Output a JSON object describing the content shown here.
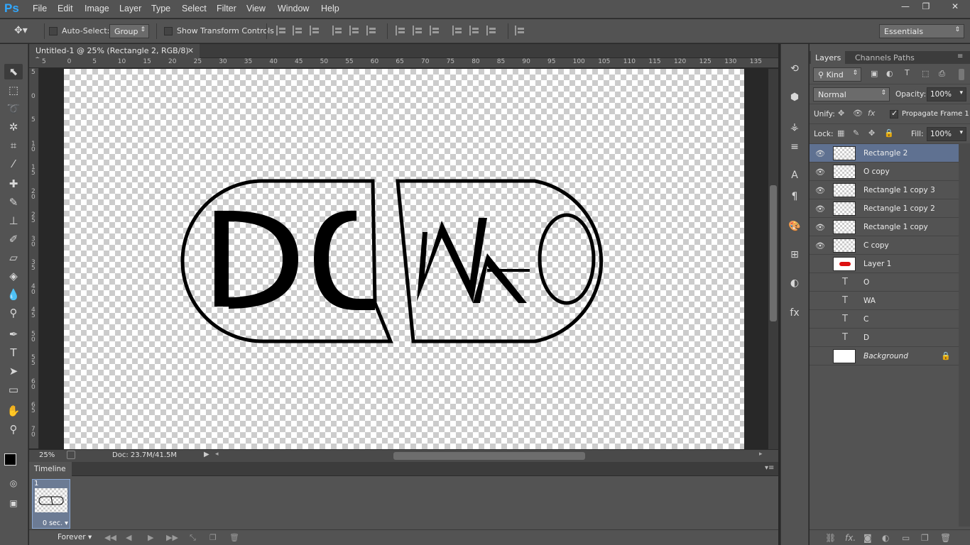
{
  "app": {
    "logo": "Ps"
  },
  "menu": [
    "File",
    "Edit",
    "Image",
    "Layer",
    "Type",
    "Select",
    "Filter",
    "View",
    "Window",
    "Help"
  ],
  "window_controls": {
    "minimize": "—",
    "restore": "❐",
    "close": "✕"
  },
  "options_bar": {
    "auto_select_label": "Auto-Select:",
    "auto_select_value": "Group",
    "transform_label": "Show Transform Controls",
    "workspace": "Essentials"
  },
  "document": {
    "tab_title": "Untitled-1 @ 25% (Rectangle 2, RGB/8) *",
    "ruler_top": [
      "5",
      "0",
      "5",
      "10",
      "15",
      "20",
      "25",
      "30",
      "35",
      "40",
      "45",
      "50",
      "55",
      "60",
      "65",
      "70",
      "75",
      "80",
      "85",
      "90",
      "95",
      "100",
      "105",
      "110",
      "115",
      "120",
      "125",
      "130",
      "135"
    ],
    "ruler_left": [
      "5",
      "0",
      "5",
      "1 0",
      "1 5",
      "2 0",
      "2 5",
      "3 0",
      "3 5",
      "4 0",
      "4 5",
      "5 0",
      "5 5",
      "6 0",
      "6 5",
      "7 0",
      "7"
    ],
    "zoom": "25%",
    "doc_size": "Doc: 23.7M/41.5M",
    "canvas_logo_text": "DCWAO"
  },
  "timeline": {
    "title": "Timeline",
    "frame_number": "1",
    "frame_delay": "0 sec.",
    "loop": "Forever"
  },
  "layers_panel": {
    "tabs": [
      "Layers",
      "Channels",
      "Paths"
    ],
    "filter_kind": "Kind",
    "blend_mode": "Normal",
    "opacity_label": "Opacity:",
    "opacity": "100%",
    "unify_label": "Unify:",
    "propagate_label": "Propagate Frame 1",
    "lock_label": "Lock:",
    "fill_label": "Fill:",
    "fill": "100%",
    "layers": [
      {
        "name": "Rectangle 2",
        "type": "raster",
        "visible": true,
        "selected": true
      },
      {
        "name": "O copy",
        "type": "raster",
        "visible": true,
        "selected": false
      },
      {
        "name": "Rectangle 1 copy 3",
        "type": "raster",
        "visible": true,
        "selected": false
      },
      {
        "name": "Rectangle 1 copy 2",
        "type": "raster",
        "visible": true,
        "selected": false
      },
      {
        "name": "Rectangle 1 copy",
        "type": "raster",
        "visible": true,
        "selected": false
      },
      {
        "name": "C copy",
        "type": "raster",
        "visible": true,
        "selected": false
      },
      {
        "name": "Layer 1",
        "type": "raster",
        "visible": false,
        "selected": false
      },
      {
        "name": "O",
        "type": "text",
        "visible": false,
        "selected": false
      },
      {
        "name": "WA",
        "type": "text",
        "visible": false,
        "selected": false
      },
      {
        "name": "C",
        "type": "text",
        "visible": false,
        "selected": false
      },
      {
        "name": "D",
        "type": "text",
        "visible": false,
        "selected": false
      },
      {
        "name": "Background",
        "type": "background",
        "visible": false,
        "selected": false
      }
    ]
  },
  "colors": {
    "ui_bg": "#535353",
    "selected_layer": "#5f7191",
    "accent_logo": "#31a8ff"
  }
}
